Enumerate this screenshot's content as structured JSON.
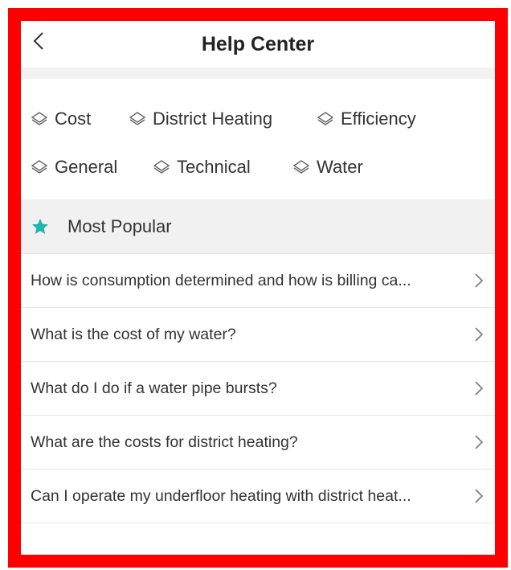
{
  "header": {
    "title": "Help Center",
    "back_icon": "chevron-left-icon"
  },
  "categories": [
    {
      "label": "Cost",
      "icon": "layers-icon"
    },
    {
      "label": "District Heating",
      "icon": "layers-icon"
    },
    {
      "label": "Efficiency",
      "icon": "layers-icon"
    },
    {
      "label": "General",
      "icon": "layers-icon"
    },
    {
      "label": "Technical",
      "icon": "layers-icon"
    },
    {
      "label": "Water",
      "icon": "layers-icon"
    }
  ],
  "popular": {
    "label": "Most Popular",
    "icon": "star-icon",
    "icon_color": "#1fb5ac",
    "items": [
      {
        "text": "How is consumption determined and how is billing ca..."
      },
      {
        "text": "What is the cost of my water?"
      },
      {
        "text": "What do I do if a water pipe bursts?"
      },
      {
        "text": "What are the costs for district heating?"
      },
      {
        "text": "Can I operate my underfloor heating with district heat..."
      }
    ]
  },
  "colors": {
    "border": "#ff0000",
    "band": "#f1f1f1"
  }
}
